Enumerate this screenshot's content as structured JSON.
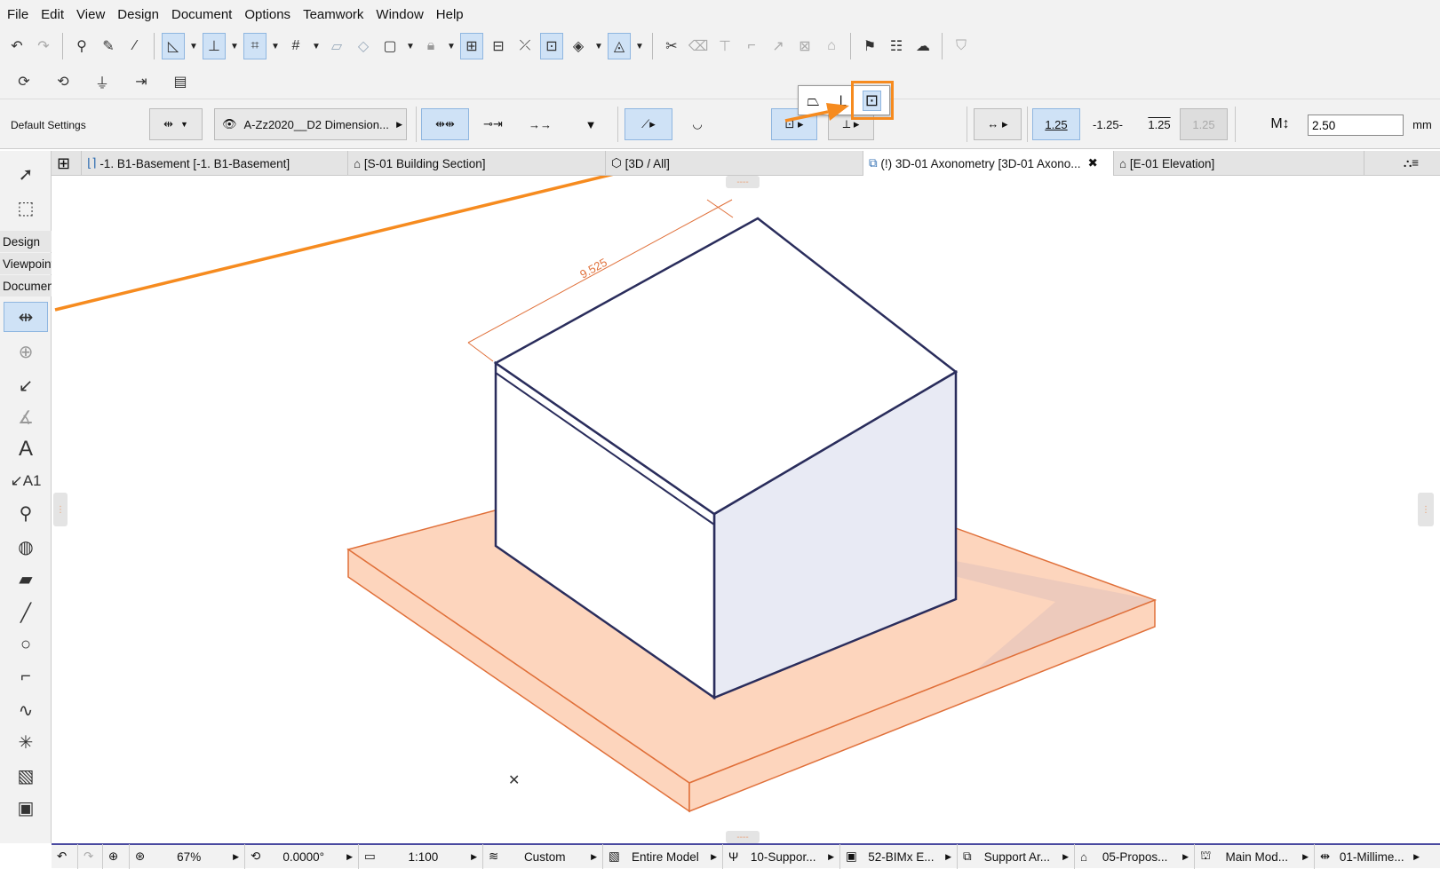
{
  "menu": [
    "File",
    "Edit",
    "View",
    "Design",
    "Document",
    "Options",
    "Teamwork",
    "Window",
    "Help"
  ],
  "info_box": {
    "settings_label": "Default Settings",
    "layer": "A-Zz2020__D2 Dimension...",
    "marker_values": [
      "1.25",
      "-1.25-",
      "1.25",
      "1.25"
    ],
    "height_value": "2.50",
    "unit": "mm"
  },
  "tabs": [
    {
      "label": "-1. B1-Basement [-1. B1-Basement]",
      "icon": "floor-plan-icon"
    },
    {
      "label": "[S-01 Building Section]",
      "icon": "section-icon"
    },
    {
      "label": "[3D / All]",
      "icon": "3d-window-icon"
    },
    {
      "label": "(!) 3D-01 Axonometry [3D-01 Axono...",
      "icon": "3d-document-icon",
      "active": true
    },
    {
      "label": "[E-01 Elevation]",
      "icon": "elevation-icon"
    }
  ],
  "toolbox": {
    "palettes": [
      "Design",
      "Viewpoint",
      "Document"
    ]
  },
  "canvas": {
    "dimension_value": "9.525",
    "accent_color": "#f68b1f",
    "slab_color": "#fdd5bd",
    "box_edge_color": "#2a2d5c"
  },
  "status_bar": {
    "zoom": "67%",
    "angle": "0.0000°",
    "scale": "1:100",
    "layer_combo": "Custom",
    "model_view": "Entire Model",
    "pen_set": "10-Suppor...",
    "mvo": "52-BIMx E...",
    "graphic_override": "Support Ar...",
    "renovation": "05-Propos...",
    "structural": "Main Mod...",
    "dimension_std": "01-Millime..."
  }
}
